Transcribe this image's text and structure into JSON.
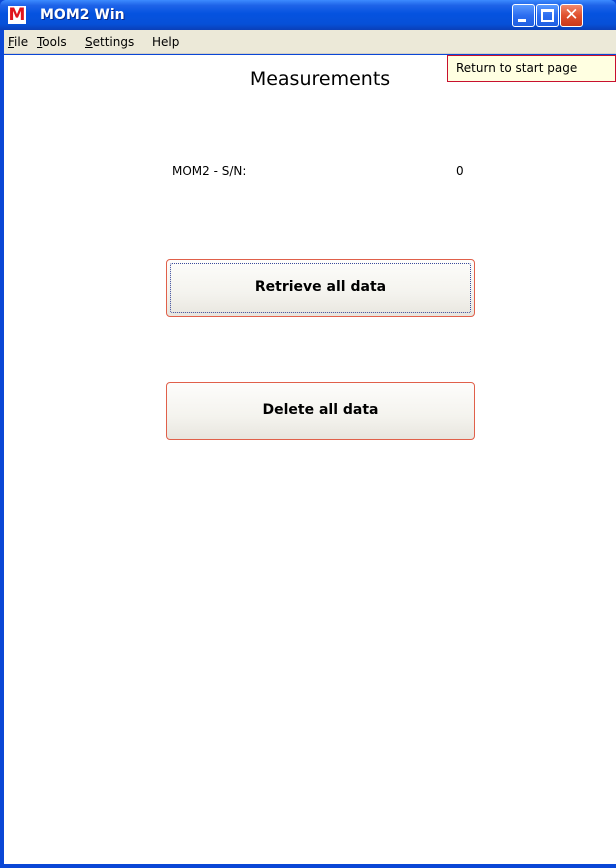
{
  "window": {
    "title": "MOM2 Win",
    "app_icon_letter": "M",
    "minimize_glyph": "",
    "close_glyph": "✕"
  },
  "menu": {
    "items": [
      {
        "first": "F",
        "rest": "ile"
      },
      {
        "first": "T",
        "rest": "ools"
      },
      {
        "first": "S",
        "rest": "ettings"
      },
      {
        "first": "",
        "rest": "Help"
      }
    ]
  },
  "tooltip": {
    "text": "Return to start page"
  },
  "main": {
    "heading": "Measurements",
    "serial_label": "MOM2 - S/N:",
    "serial_value": "0",
    "retrieve_button": "Retrieve all data",
    "delete_button": "Delete all data"
  },
  "colors": {
    "titlebar": "#0553e0",
    "button_border": "#e0604a",
    "app_icon": "#e0141c"
  }
}
